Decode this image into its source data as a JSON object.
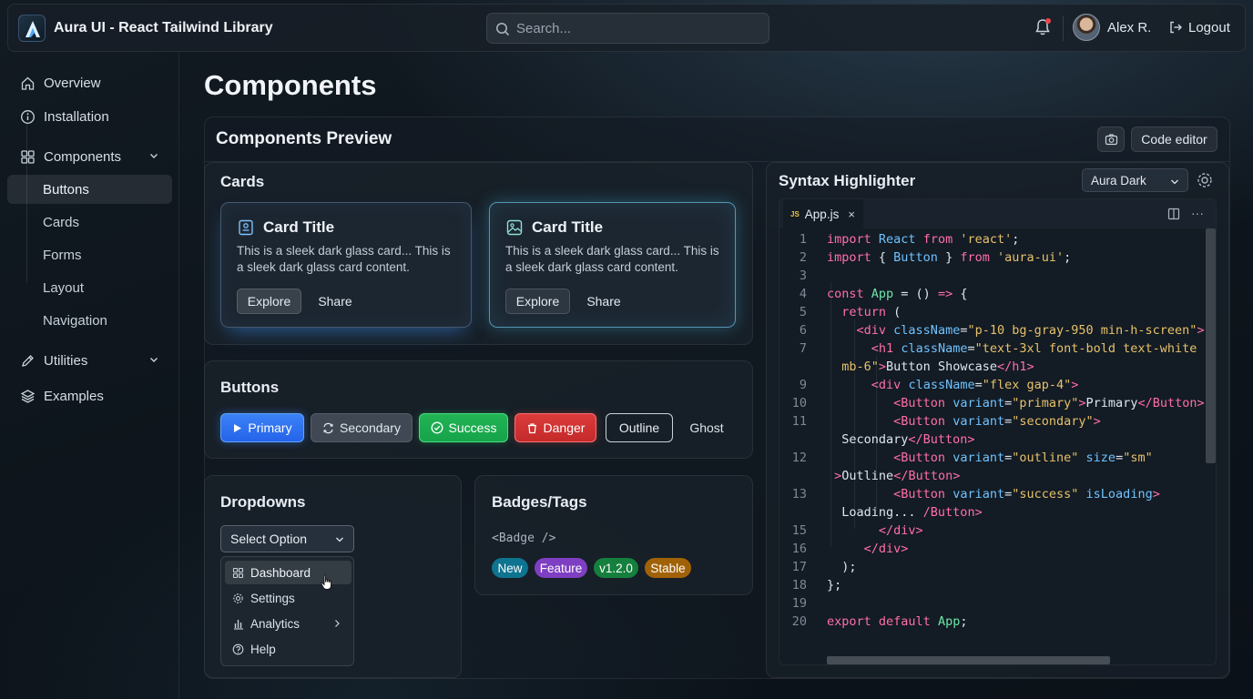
{
  "app": {
    "title": "Aura UI - React Tailwind Library"
  },
  "search": {
    "placeholder": "Search..."
  },
  "user": {
    "name": "Alex R.",
    "logout": "Logout",
    "has_notification": true
  },
  "sidebar": {
    "items": [
      {
        "label": "Overview",
        "icon": "home-icon"
      },
      {
        "label": "Installation",
        "icon": "info-icon"
      },
      {
        "label": "Components",
        "icon": "grid-icon",
        "expanded": true
      },
      {
        "label": "Utilities",
        "icon": "pencil-icon",
        "expanded": false
      },
      {
        "label": "Examples",
        "icon": "layers-icon"
      }
    ],
    "components_sub": [
      "Buttons",
      "Cards",
      "Forms",
      "Layout",
      "Navigation"
    ],
    "active_sub": "Buttons"
  },
  "page": {
    "title": "Components"
  },
  "preview": {
    "title": "Components Preview",
    "code_editor_label": "Code editor",
    "cards": {
      "title": "Cards",
      "items": [
        {
          "title": "Card Title",
          "text": "This is a sleek dark glass card... This is a sleek dark glass card content.",
          "explore": "Explore",
          "share": "Share"
        },
        {
          "title": "Card Title",
          "text": "This is a sleek dark glass card... This is a sleek dark glass card content.",
          "explore": "Explore",
          "share": "Share"
        }
      ]
    },
    "buttons": {
      "title": "Buttons",
      "primary": "Primary",
      "secondary": "Secondary",
      "success": "Success",
      "danger": "Danger",
      "outline": "Outline",
      "ghost": "Ghost"
    },
    "dropdowns": {
      "title": "Dropdowns",
      "select_label": "Select Option",
      "options": [
        "Dashboard",
        "Settings",
        "Analytics",
        "Help"
      ],
      "hovered": "Dashboard"
    },
    "badges": {
      "title": "Badges/Tags",
      "code": "<Badge />",
      "items": [
        {
          "label": "New",
          "color": "#0e7490"
        },
        {
          "label": "Feature",
          "color": "#7e3fc2"
        },
        {
          "label": "v1.2.0",
          "color": "#15803d"
        },
        {
          "label": "Stable",
          "color": "#a16207"
        }
      ]
    },
    "highlighter": {
      "title": "Syntax Highlighter",
      "theme": "Aura Dark",
      "tab": "App.js",
      "tab_badge": "JS",
      "line_numbers": [
        "1",
        "2",
        "3",
        "4",
        "5",
        "6",
        "7",
        "",
        "9",
        "10",
        "11",
        "",
        "12",
        "",
        "13",
        "",
        "15",
        "16",
        "17",
        "18",
        "19",
        "20"
      ]
    }
  },
  "colors": {
    "primary": "#3b82f6",
    "success": "#16a34a",
    "danger": "#dc2626",
    "accent": "#4cc3e6"
  }
}
